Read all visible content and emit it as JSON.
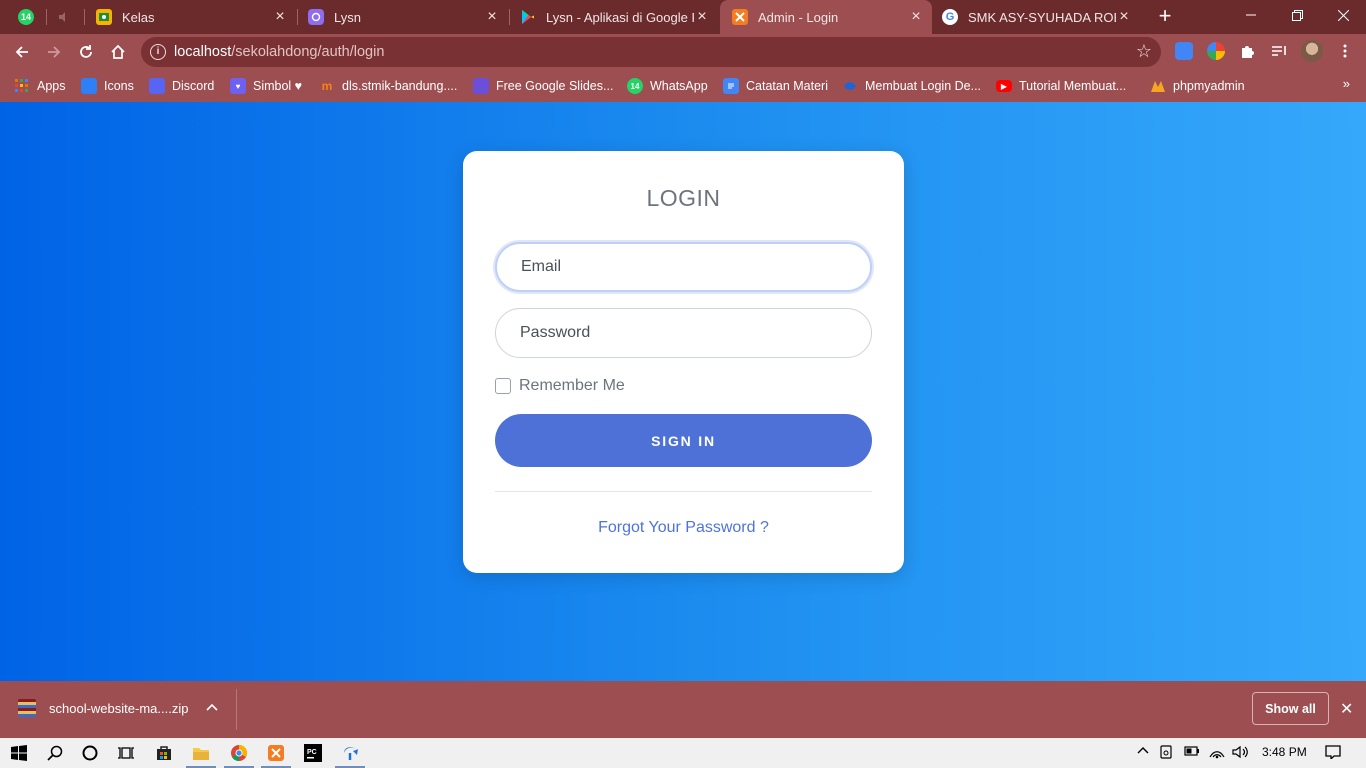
{
  "browser": {
    "tabs": [
      {
        "title": "",
        "icon": "whatsapp-icon",
        "badge": "14",
        "color": "#25d366",
        "active": false
      },
      {
        "title": "",
        "icon": "muted-speaker-icon",
        "color": "#9a6466",
        "active": false
      },
      {
        "title": "Kelas",
        "icon": "classroom-icon",
        "color": "#f6b300",
        "active": false
      },
      {
        "title": "Lysn",
        "icon": "lysn-icon",
        "color": "#8e6cf0",
        "active": false
      },
      {
        "title": "Lysn - Aplikasi di Google Pla",
        "icon": "google-play-icon",
        "color": "#00c4ff",
        "active": false
      },
      {
        "title": "Admin - Login",
        "icon": "xampp-icon",
        "color": "#f37d20",
        "active": true
      },
      {
        "title": "SMK ASY-SYUHADA ROESLY",
        "icon": "google-icon",
        "color": "#ffffff",
        "active": false
      }
    ],
    "new_tab_label": "+",
    "url": {
      "host": "localhost",
      "path": "/sekolahdong/auth/login"
    },
    "bookmarks": [
      {
        "label": "Apps",
        "icon": "apps-grid-icon",
        "color": "#e8710a"
      },
      {
        "label": "Icons",
        "icon": "icons-bookmark-icon",
        "color": "#2f7ff7"
      },
      {
        "label": "Discord",
        "icon": "discord-icon",
        "color": "#5865f2"
      },
      {
        "label": "Simbol ♥",
        "icon": "simbol-icon",
        "color": "#6e61f2"
      },
      {
        "label": "dls.stmik-bandung....",
        "icon": "moodle-icon",
        "color": "#f98012"
      },
      {
        "label": "Free Google Slides...",
        "icon": "slides-icon",
        "color": "#6b4fd8"
      },
      {
        "label": "WhatsApp",
        "icon": "whatsapp-icon",
        "color": "#25d366",
        "badge": "14"
      },
      {
        "label": "Catatan Materi",
        "icon": "docs-icon",
        "color": "#4285f4"
      },
      {
        "label": "Membuat Login De...",
        "icon": "bookmark-link-icon",
        "color": "#1d64d8"
      },
      {
        "label": "Tutorial Membuat...",
        "icon": "youtube-icon",
        "color": "#ff0000"
      },
      {
        "label": "phpmyadmin",
        "icon": "phpmyadmin-icon",
        "color": "#f5a623"
      }
    ]
  },
  "login": {
    "title": "LOGIN",
    "email_placeholder": "Email",
    "password_placeholder": "Password",
    "remember_label": "Remember Me",
    "submit_label": "SIGN IN",
    "forgot_label": "Forgot Your Password ?"
  },
  "download_bar": {
    "file_name": "school-website-ma....zip",
    "show_all_label": "Show all"
  },
  "taskbar": {
    "time": "3:48 PM"
  },
  "colors": {
    "browser_frame": "#9c4e51",
    "tab_strip": "#6b2a2c",
    "page_gradient_start": "#0063e6",
    "page_gradient_end": "#35a8fb",
    "button_primary": "#4e71d8",
    "link": "#4e73df"
  }
}
